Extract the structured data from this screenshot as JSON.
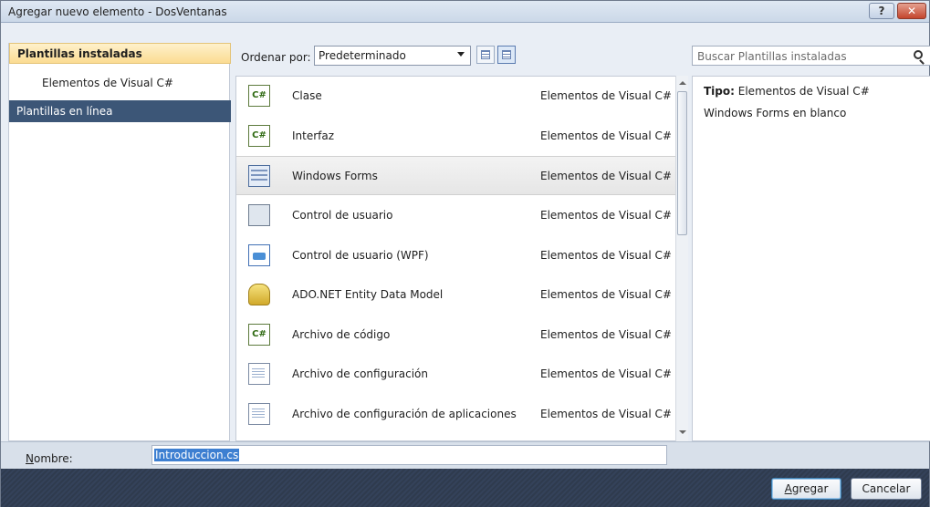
{
  "window": {
    "title": "Agregar nuevo elemento - DosVentanas",
    "help_label": "?",
    "close_label": "✕"
  },
  "left_pane": {
    "header": "Plantillas instaladas",
    "item": "Elementos de Visual C#",
    "online": "Plantillas en línea"
  },
  "toolbar": {
    "sort_label": "Ordenar por:",
    "sort_value": "Predeterminado",
    "search_placeholder": "Buscar Plantillas instaladas"
  },
  "templates": [
    {
      "name": "Clase",
      "category": "Elementos de Visual C#",
      "icon": "class-icon"
    },
    {
      "name": "Interfaz",
      "category": "Elementos de Visual C#",
      "icon": "interface-icon"
    },
    {
      "name": "Windows Forms",
      "category": "Elementos de Visual C#",
      "icon": "windows-forms-icon",
      "selected": true
    },
    {
      "name": "Control de usuario",
      "category": "Elementos de Visual C#",
      "icon": "user-control-icon"
    },
    {
      "name": "Control de usuario (WPF)",
      "category": "Elementos de Visual C#",
      "icon": "wpf-user-control-icon"
    },
    {
      "name": "ADO.NET Entity Data Model",
      "category": "Elementos de Visual C#",
      "icon": "entity-data-model-icon"
    },
    {
      "name": "Archivo de código",
      "category": "Elementos de Visual C#",
      "icon": "code-file-icon"
    },
    {
      "name": "Archivo de configuración",
      "category": "Elementos de Visual C#",
      "icon": "config-file-icon"
    },
    {
      "name": "Archivo de configuración de aplicaciones",
      "category": "Elementos de Visual C#",
      "icon": "app-config-file-icon"
    }
  ],
  "details": {
    "type_label": "Tipo:",
    "type_value": "Elementos de Visual C#",
    "description": "Windows Forms en blanco"
  },
  "bottom": {
    "name_label_first": "N",
    "name_label_rest": "ombre:",
    "name_value": "Introduccion.cs"
  },
  "buttons": {
    "add_first": "A",
    "add_rest": "gregar",
    "cancel": "Cancelar"
  }
}
